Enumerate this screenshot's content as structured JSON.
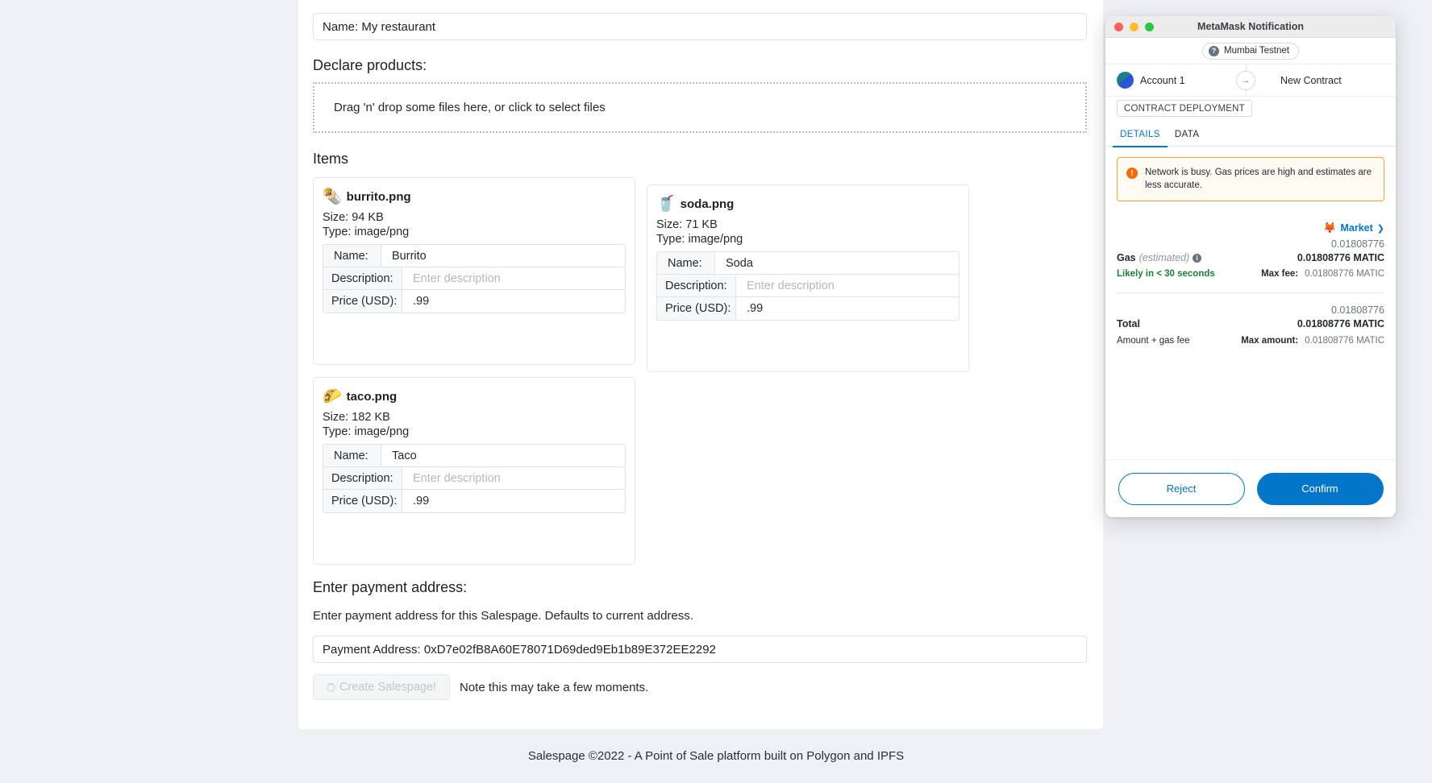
{
  "page": {
    "restaurant_name_value": "Name: My restaurant",
    "declare_products_heading": "Declare products:",
    "dropzone_text": "Drag 'n' drop some files here, or click to select files",
    "items_heading": "Items",
    "payment_heading": "Enter payment address:",
    "payment_description": "Enter payment address for this Salespage. Defaults to current address.",
    "payment_address_value": "Payment Address: 0xD7e02fB8A60E78071D69ded9Eb1b89E372EE2292",
    "create_button_label": "Create Salespage!",
    "create_note": "Note this may take a few moments.",
    "footer_text": "Salespage ©2022 - A Point of Sale platform built on Polygon and IPFS"
  },
  "items": [
    {
      "emoji": "🌯",
      "file_name": "burrito.png",
      "size": "Size: 94 KB",
      "type": "Type: image/png",
      "name_label": "Name:",
      "name_value": "Burrito",
      "description_label": "Description:",
      "description_placeholder": "Enter description",
      "price_label": "Price (USD):",
      "price_value": ".99"
    },
    {
      "emoji": "🥤",
      "file_name": "soda.png",
      "size": "Size: 71 KB",
      "type": "Type: image/png",
      "name_label": "Name:",
      "name_value": "Soda",
      "description_label": "Description:",
      "description_placeholder": "Enter description",
      "price_label": "Price (USD):",
      "price_value": ".99"
    },
    {
      "emoji": "🌮",
      "file_name": "taco.png",
      "size": "Size: 182 KB",
      "type": "Type: image/png",
      "name_label": "Name:",
      "name_value": "Taco",
      "description_label": "Description:",
      "description_placeholder": "Enter description",
      "price_label": "Price (USD):",
      "price_value": ".99"
    }
  ],
  "metamask": {
    "window_title": "MetaMask Notification",
    "network_name": "Mumbai Testnet",
    "network_icon_glyph": "?",
    "account_name": "Account 1",
    "recipient_name": "New Contract",
    "transfer_arrow_glyph": "→",
    "deployment_tag": "CONTRACT DEPLOYMENT",
    "tabs": [
      {
        "label": "DETAILS",
        "active": true
      },
      {
        "label": "DATA",
        "active": false
      }
    ],
    "warning": {
      "icon_glyph": "!",
      "text": "Network is busy. Gas prices are high and estimates are less accurate."
    },
    "market": {
      "fox_glyph": "🦊",
      "label": "Market",
      "chevron_glyph": "❯"
    },
    "gas": {
      "fiat_amount": "0.01808776",
      "label_bold": "Gas",
      "label_italic": "(estimated)",
      "info_glyph": "i",
      "value": "0.01808776 MATIC",
      "speed_text": "Likely in < 30 seconds",
      "max_fee_label": "Max fee:",
      "max_fee_value": "0.01808776 MATIC"
    },
    "total": {
      "fiat_amount": "0.01808776",
      "label": "Total",
      "value": "0.01808776 MATIC",
      "sub_label": "Amount + gas fee",
      "max_amount_label": "Max amount:",
      "max_amount_value": "0.01808776 MATIC"
    },
    "reject_label": "Reject",
    "confirm_label": "Confirm",
    "accent_color": "#0376c9",
    "warning_border_color": "#f8a33c",
    "success_color": "#1c8234"
  }
}
